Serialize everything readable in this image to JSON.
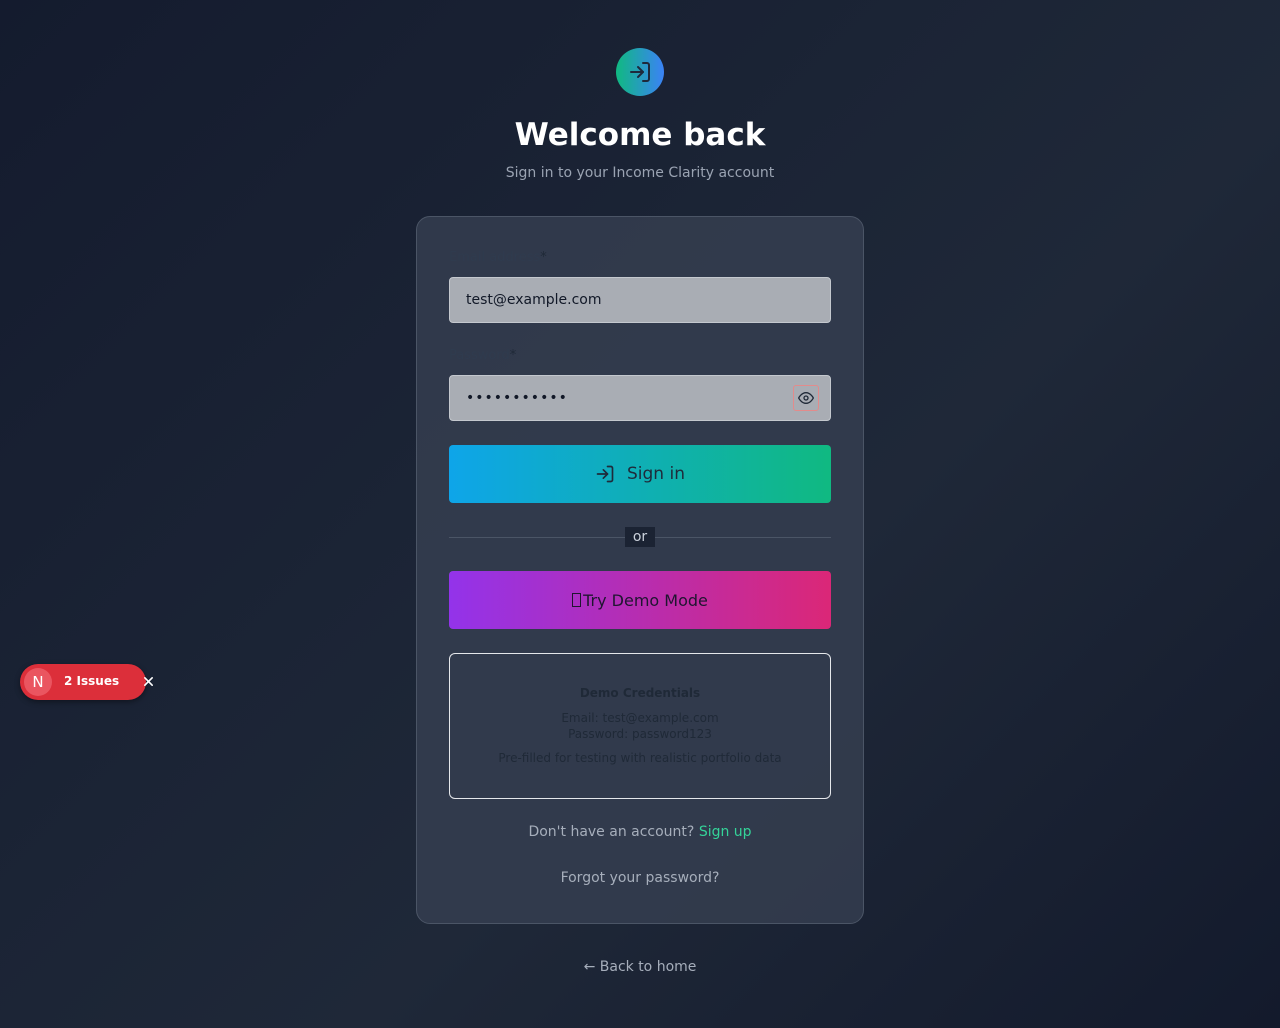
{
  "header": {
    "icon": "login-icon",
    "title": "Welcome back",
    "subtitle": "Sign in to your Income Clarity account"
  },
  "form": {
    "email_label": "Email address",
    "email_value": "test@example.com",
    "password_label": "Password",
    "password_value": "•••••••••••",
    "required_mark": "*",
    "toggle_icon": "eye-icon",
    "signin_label": "Sign in",
    "signin_icon": "login-icon",
    "divider_label": "or",
    "demo_icon": "missing-glyph",
    "demo_label": " Try Demo Mode"
  },
  "demo_credentials": {
    "title": "Demo Credentials",
    "email_line": "Email: test@example.com",
    "password_line": "Password: password123",
    "note": "Pre-filled for testing with realistic portfolio data"
  },
  "footer": {
    "signup_prompt": "Don't have an account?",
    "signup_link": "Sign up",
    "forgot_link": "Forgot your password?",
    "back_link": "← Back to home"
  },
  "dev_overlay": {
    "logo_letter": "N",
    "issues_label": "2 Issues",
    "close_icon": "close-icon"
  },
  "colors": {
    "accent_green": "#10b981",
    "accent_blue": "#0ea5e9",
    "demo_purple": "#9333ea",
    "demo_pink": "#db2777",
    "link_green": "#34d399",
    "issues_red": "#dc2f3a"
  }
}
